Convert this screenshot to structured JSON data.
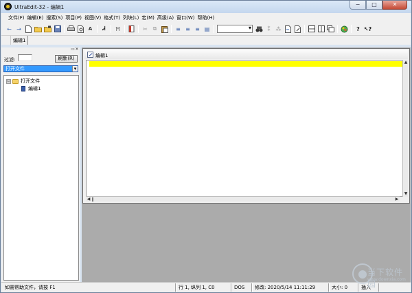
{
  "window": {
    "title": "UltraEdit-32 - 编辑1",
    "controls": {
      "minimize": "−",
      "maximize": "□",
      "close": "✕"
    }
  },
  "menu": [
    "文件(F)",
    "编辑(E)",
    "搜索(S)",
    "项目(P)",
    "视图(V)",
    "格式(T)",
    "列块(L)",
    "宏(M)",
    "高级(A)",
    "窗口(W)",
    "帮助(H)"
  ],
  "toolbar": {
    "groups": [
      [
        "back-arrow-icon",
        "forward-arrow-icon",
        "new-file-icon",
        "open-folder-icon",
        "open-lock-icon",
        "save-icon"
      ],
      [
        "print-icon",
        "print-preview-icon",
        "font-a-icon"
      ],
      [
        "find-icon",
        "word-wrap-icon"
      ],
      [
        "bookmark-icon"
      ],
      [
        "cut-icon",
        "copy-icon",
        "paste-icon"
      ],
      [
        "align-left-icon",
        "align-center-icon",
        "align-right-icon",
        "justify-icon"
      ],
      [
        "binoculars-icon",
        "find-next-icon",
        "find-in-files-icon",
        "replace-icon",
        "goto-icon"
      ],
      [
        "split-horizontal-icon",
        "split-vertical-icon",
        "window-icon"
      ],
      [
        "color-icon"
      ],
      [
        "help-icon",
        "context-help-icon"
      ]
    ],
    "combo_value": ""
  },
  "tabs": [
    {
      "label": "编辑1"
    }
  ],
  "left_panel": {
    "filter_label": "过滤:",
    "filter_value": "",
    "refresh_label": "刷新(R)",
    "selector_value": "打开文件",
    "tree": {
      "root": {
        "label": "打开文件",
        "expander": "⊟"
      },
      "children": [
        {
          "label": "编辑1"
        }
      ]
    }
  },
  "editor": {
    "window_title": "编辑1",
    "content": ""
  },
  "status": {
    "help": "如需帮助文件，请按 F1",
    "position": "行 1, 纵列 1, C0",
    "line_ending": "DOS",
    "modified": "修改: 2020/5/14 11:11:29",
    "size": "大小: 0",
    "mode": "插入"
  },
  "watermark": {
    "text": "当下软件园",
    "sub": "www.downxia.com"
  }
}
